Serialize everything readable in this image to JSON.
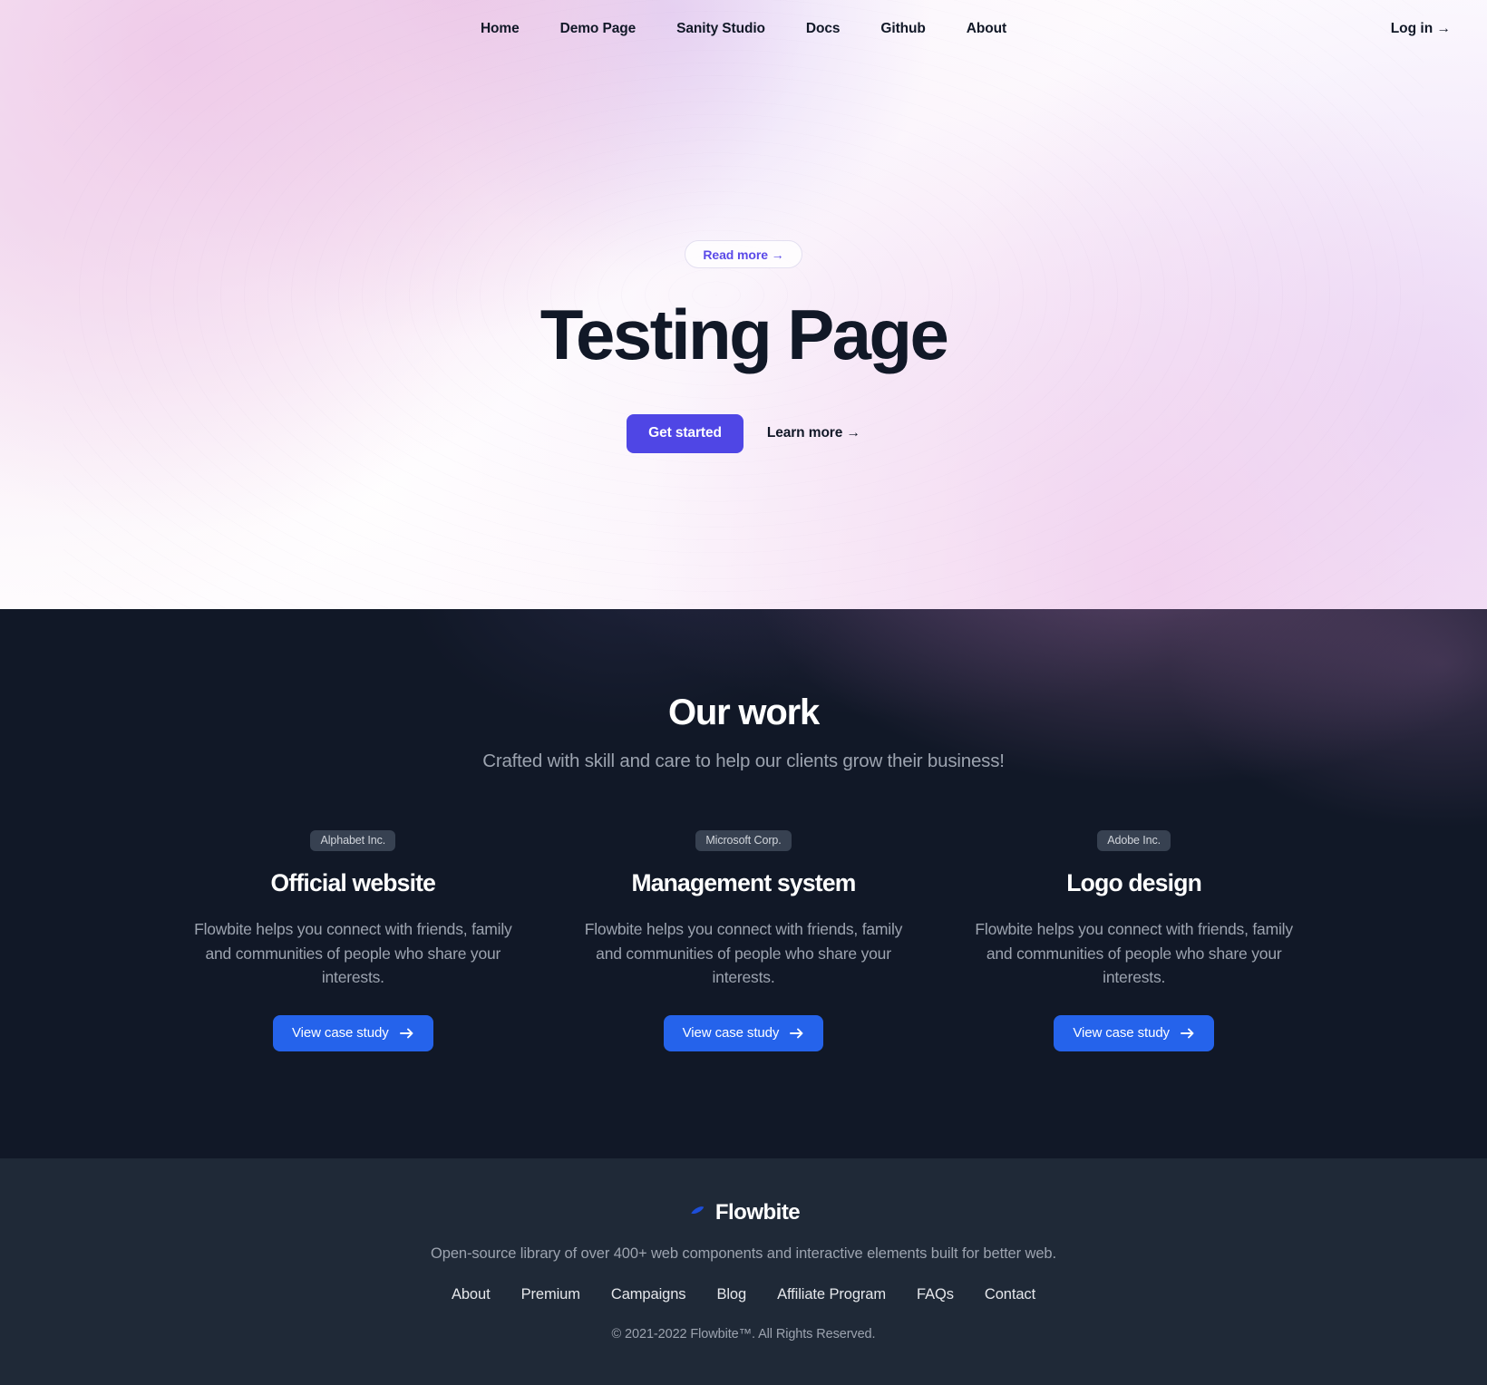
{
  "nav": {
    "links": [
      {
        "label": "Home"
      },
      {
        "label": "Demo Page"
      },
      {
        "label": "Sanity Studio"
      },
      {
        "label": "Docs"
      },
      {
        "label": "Github"
      },
      {
        "label": "About"
      }
    ],
    "login_label": "Log in →"
  },
  "hero": {
    "pill_label": "Read more →",
    "title": "Testing Page",
    "primary_cta": "Get started",
    "secondary_cta": "Learn more →"
  },
  "work": {
    "title": "Our work",
    "subtitle": "Crafted with skill and care to help our clients grow their business!",
    "cards": [
      {
        "badge": "Alphabet Inc.",
        "title": "Official website",
        "text": "Flowbite helps you connect with friends, family and communities of people who share your interests.",
        "cta": "View case study"
      },
      {
        "badge": "Microsoft Corp.",
        "title": "Management system",
        "text": "Flowbite helps you connect with friends, family and communities of people who share your interests.",
        "cta": "View case study"
      },
      {
        "badge": "Adobe Inc.",
        "title": "Logo design",
        "text": "Flowbite helps you connect with friends, family and communities of people who share your interests.",
        "cta": "View case study"
      }
    ]
  },
  "footer": {
    "brand": "Flowbite",
    "tagline": "Open-source library of over 400+ web components and interactive elements built for better web.",
    "links": [
      {
        "label": "About"
      },
      {
        "label": "Premium"
      },
      {
        "label": "Campaigns"
      },
      {
        "label": "Blog"
      },
      {
        "label": "Affiliate Program"
      },
      {
        "label": "FAQs"
      },
      {
        "label": "Contact"
      }
    ],
    "copyright": "© 2021-2022 Flowbite™. All Rights Reserved."
  },
  "colors": {
    "hero_primary": "#4f46e5",
    "pill_text": "#5b4ae8",
    "card_button": "#2563eb",
    "dark_section": "#111827",
    "footer_bg": "#1f2937",
    "brand_mark": "#1d4ed8"
  }
}
